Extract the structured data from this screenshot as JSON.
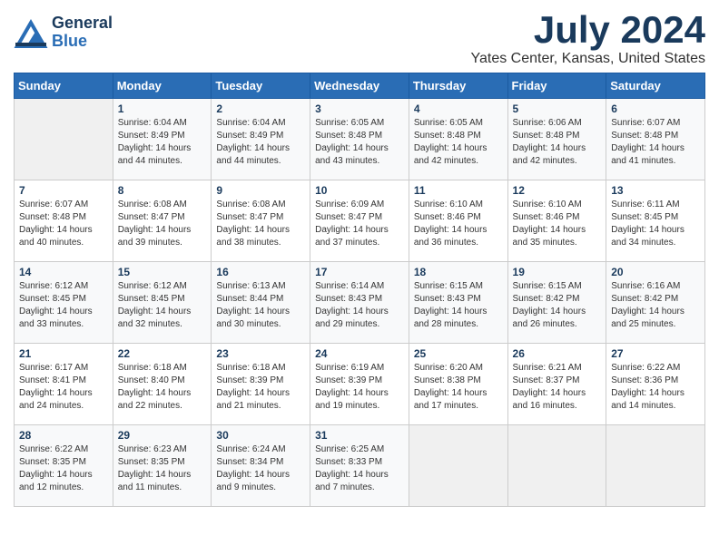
{
  "header": {
    "logo_line1": "General",
    "logo_line2": "Blue",
    "month_year": "July 2024",
    "location": "Yates Center, Kansas, United States"
  },
  "weekdays": [
    "Sunday",
    "Monday",
    "Tuesday",
    "Wednesday",
    "Thursday",
    "Friday",
    "Saturday"
  ],
  "weeks": [
    [
      {
        "day": "",
        "sunrise": "",
        "sunset": "",
        "daylight": "",
        "empty": true
      },
      {
        "day": "1",
        "sunrise": "6:04 AM",
        "sunset": "8:49 PM",
        "daylight": "14 hours and 44 minutes.",
        "empty": false
      },
      {
        "day": "2",
        "sunrise": "6:04 AM",
        "sunset": "8:49 PM",
        "daylight": "14 hours and 44 minutes.",
        "empty": false
      },
      {
        "day": "3",
        "sunrise": "6:05 AM",
        "sunset": "8:48 PM",
        "daylight": "14 hours and 43 minutes.",
        "empty": false
      },
      {
        "day": "4",
        "sunrise": "6:05 AM",
        "sunset": "8:48 PM",
        "daylight": "14 hours and 42 minutes.",
        "empty": false
      },
      {
        "day": "5",
        "sunrise": "6:06 AM",
        "sunset": "8:48 PM",
        "daylight": "14 hours and 42 minutes.",
        "empty": false
      },
      {
        "day": "6",
        "sunrise": "6:07 AM",
        "sunset": "8:48 PM",
        "daylight": "14 hours and 41 minutes.",
        "empty": false
      }
    ],
    [
      {
        "day": "7",
        "sunrise": "6:07 AM",
        "sunset": "8:48 PM",
        "daylight": "14 hours and 40 minutes.",
        "empty": false
      },
      {
        "day": "8",
        "sunrise": "6:08 AM",
        "sunset": "8:47 PM",
        "daylight": "14 hours and 39 minutes.",
        "empty": false
      },
      {
        "day": "9",
        "sunrise": "6:08 AM",
        "sunset": "8:47 PM",
        "daylight": "14 hours and 38 minutes.",
        "empty": false
      },
      {
        "day": "10",
        "sunrise": "6:09 AM",
        "sunset": "8:47 PM",
        "daylight": "14 hours and 37 minutes.",
        "empty": false
      },
      {
        "day": "11",
        "sunrise": "6:10 AM",
        "sunset": "8:46 PM",
        "daylight": "14 hours and 36 minutes.",
        "empty": false
      },
      {
        "day": "12",
        "sunrise": "6:10 AM",
        "sunset": "8:46 PM",
        "daylight": "14 hours and 35 minutes.",
        "empty": false
      },
      {
        "day": "13",
        "sunrise": "6:11 AM",
        "sunset": "8:45 PM",
        "daylight": "14 hours and 34 minutes.",
        "empty": false
      }
    ],
    [
      {
        "day": "14",
        "sunrise": "6:12 AM",
        "sunset": "8:45 PM",
        "daylight": "14 hours and 33 minutes.",
        "empty": false
      },
      {
        "day": "15",
        "sunrise": "6:12 AM",
        "sunset": "8:45 PM",
        "daylight": "14 hours and 32 minutes.",
        "empty": false
      },
      {
        "day": "16",
        "sunrise": "6:13 AM",
        "sunset": "8:44 PM",
        "daylight": "14 hours and 30 minutes.",
        "empty": false
      },
      {
        "day": "17",
        "sunrise": "6:14 AM",
        "sunset": "8:43 PM",
        "daylight": "14 hours and 29 minutes.",
        "empty": false
      },
      {
        "day": "18",
        "sunrise": "6:15 AM",
        "sunset": "8:43 PM",
        "daylight": "14 hours and 28 minutes.",
        "empty": false
      },
      {
        "day": "19",
        "sunrise": "6:15 AM",
        "sunset": "8:42 PM",
        "daylight": "14 hours and 26 minutes.",
        "empty": false
      },
      {
        "day": "20",
        "sunrise": "6:16 AM",
        "sunset": "8:42 PM",
        "daylight": "14 hours and 25 minutes.",
        "empty": false
      }
    ],
    [
      {
        "day": "21",
        "sunrise": "6:17 AM",
        "sunset": "8:41 PM",
        "daylight": "14 hours and 24 minutes.",
        "empty": false
      },
      {
        "day": "22",
        "sunrise": "6:18 AM",
        "sunset": "8:40 PM",
        "daylight": "14 hours and 22 minutes.",
        "empty": false
      },
      {
        "day": "23",
        "sunrise": "6:18 AM",
        "sunset": "8:39 PM",
        "daylight": "14 hours and 21 minutes.",
        "empty": false
      },
      {
        "day": "24",
        "sunrise": "6:19 AM",
        "sunset": "8:39 PM",
        "daylight": "14 hours and 19 minutes.",
        "empty": false
      },
      {
        "day": "25",
        "sunrise": "6:20 AM",
        "sunset": "8:38 PM",
        "daylight": "14 hours and 17 minutes.",
        "empty": false
      },
      {
        "day": "26",
        "sunrise": "6:21 AM",
        "sunset": "8:37 PM",
        "daylight": "14 hours and 16 minutes.",
        "empty": false
      },
      {
        "day": "27",
        "sunrise": "6:22 AM",
        "sunset": "8:36 PM",
        "daylight": "14 hours and 14 minutes.",
        "empty": false
      }
    ],
    [
      {
        "day": "28",
        "sunrise": "6:22 AM",
        "sunset": "8:35 PM",
        "daylight": "14 hours and 12 minutes.",
        "empty": false
      },
      {
        "day": "29",
        "sunrise": "6:23 AM",
        "sunset": "8:35 PM",
        "daylight": "14 hours and 11 minutes.",
        "empty": false
      },
      {
        "day": "30",
        "sunrise": "6:24 AM",
        "sunset": "8:34 PM",
        "daylight": "14 hours and 9 minutes.",
        "empty": false
      },
      {
        "day": "31",
        "sunrise": "6:25 AM",
        "sunset": "8:33 PM",
        "daylight": "14 hours and 7 minutes.",
        "empty": false
      },
      {
        "day": "",
        "sunrise": "",
        "sunset": "",
        "daylight": "",
        "empty": true
      },
      {
        "day": "",
        "sunrise": "",
        "sunset": "",
        "daylight": "",
        "empty": true
      },
      {
        "day": "",
        "sunrise": "",
        "sunset": "",
        "daylight": "",
        "empty": true
      }
    ]
  ],
  "labels": {
    "sunrise_prefix": "Sunrise: ",
    "sunset_prefix": "Sunset: ",
    "daylight_prefix": "Daylight: "
  },
  "colors": {
    "header_bg": "#2a6db5",
    "logo_color": "#1a3a5c",
    "title_color": "#1a3a5c"
  }
}
